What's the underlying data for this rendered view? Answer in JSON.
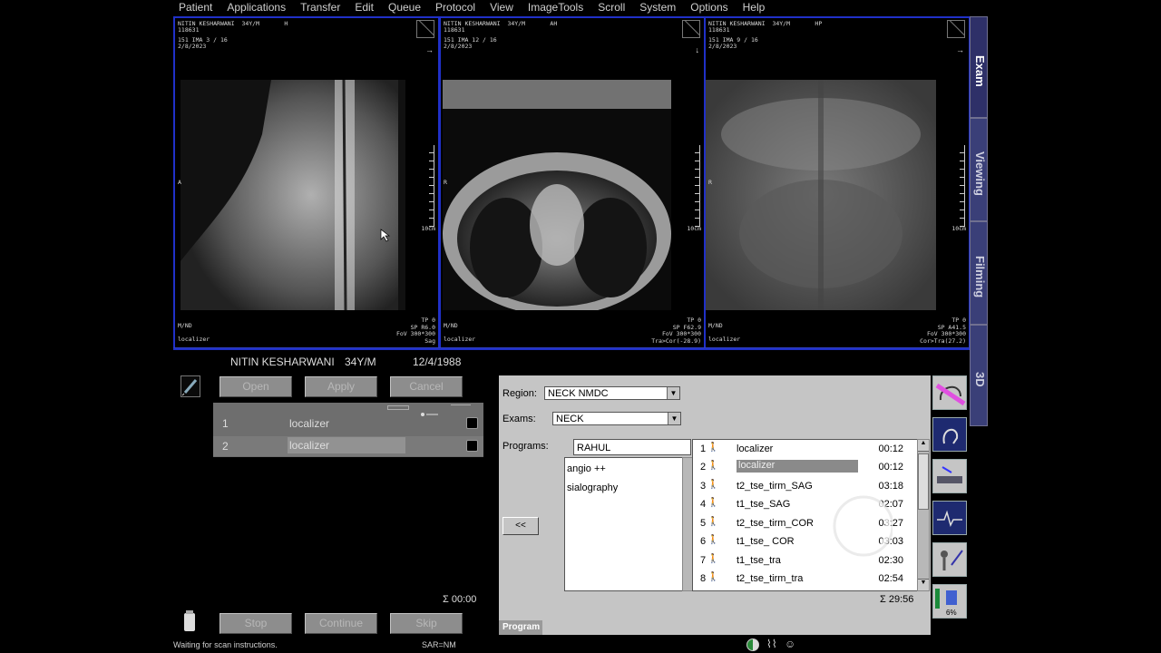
{
  "menu": [
    "Patient",
    "Applications",
    "Transfer",
    "Edit",
    "Queue",
    "Protocol",
    "View",
    "ImageTools",
    "Scroll",
    "System",
    "Options",
    "Help"
  ],
  "viewports": [
    {
      "header": "NITIN KESHARWANI  34Y/M       H",
      "id": "118631",
      "ima": "151 IMA 3 / 16",
      "date": "2/8/2023",
      "orient_left": "A",
      "scale": "10cm",
      "footer_left": "M/ND\n\nlocalizer",
      "footer_right": "TP 0\nSP R6.0\nFoV 300*300\nSag",
      "arrow": "→"
    },
    {
      "header": "NITIN KESHARWANI  34Y/M       AH",
      "id": "118631",
      "ima": "151 IMA 12 / 16",
      "date": "2/8/2023",
      "orient_left": "R",
      "scale": "10cm",
      "footer_left": "M/ND\n\nlocalizer",
      "footer_right": "TP 0\nSP F62.9\nFoV 300*300\nTra>Cor(-28.9)",
      "arrow": "↓"
    },
    {
      "header": "NITIN KESHARWANI  34Y/M       HP",
      "id": "118631",
      "ima": "151 IMA 9 / 16",
      "date": "2/8/2023",
      "orient_left": "R",
      "scale": "10cm",
      "footer_left": "M/ND\n\nlocalizer",
      "footer_right": "TP 0\nSP A41.5\nFoV 300*300\nCor>Tra(27.2)",
      "arrow": "→"
    }
  ],
  "side_tabs": [
    "Exam",
    "Viewing",
    "Filming",
    "3D"
  ],
  "patient": {
    "name": "NITIN KESHARWANI",
    "age": "34Y/M",
    "dob": "12/4/1988"
  },
  "queue_buttons": {
    "open": "Open",
    "apply": "Apply",
    "cancel": "Cancel"
  },
  "queue": [
    {
      "num": "1",
      "name": "localizer"
    },
    {
      "num": "2",
      "name": "localizer"
    }
  ],
  "total_time_left": "Σ 00:00",
  "scan_buttons": {
    "stop": "Stop",
    "continue": "Continue",
    "skip": "Skip"
  },
  "program": {
    "region_label": "Region:",
    "region_value": "NECK NMDC",
    "exams_label": "Exams:",
    "exams_value": "NECK",
    "programs_label": "Programs:",
    "programs_value": "RAHUL",
    "program_list": [
      "angio ++",
      "sialography"
    ],
    "back_button": "<<",
    "steps": [
      {
        "num": "1",
        "name": "localizer",
        "time": "00:12"
      },
      {
        "num": "2",
        "name": "localizer",
        "time": "00:12"
      },
      {
        "num": "3",
        "name": "t2_tse_tirm_SAG",
        "time": "03:18"
      },
      {
        "num": "4",
        "name": "t1_tse_SAG",
        "time": "02:07"
      },
      {
        "num": "5",
        "name": "t2_tse_tirm_COR",
        "time": "03:27"
      },
      {
        "num": "6",
        "name": "t1_tse_ COR",
        "time": "03:03"
      },
      {
        "num": "7",
        "name": "t1_tse_tra",
        "time": "02:30"
      },
      {
        "num": "8",
        "name": "t2_tse_tirm_tra",
        "time": "02:54"
      }
    ],
    "total": "Σ 29:56",
    "tab": "Program"
  },
  "sar_percent": "6%",
  "status": {
    "message": "Waiting for scan instructions.",
    "sar": "SAR=NM"
  }
}
